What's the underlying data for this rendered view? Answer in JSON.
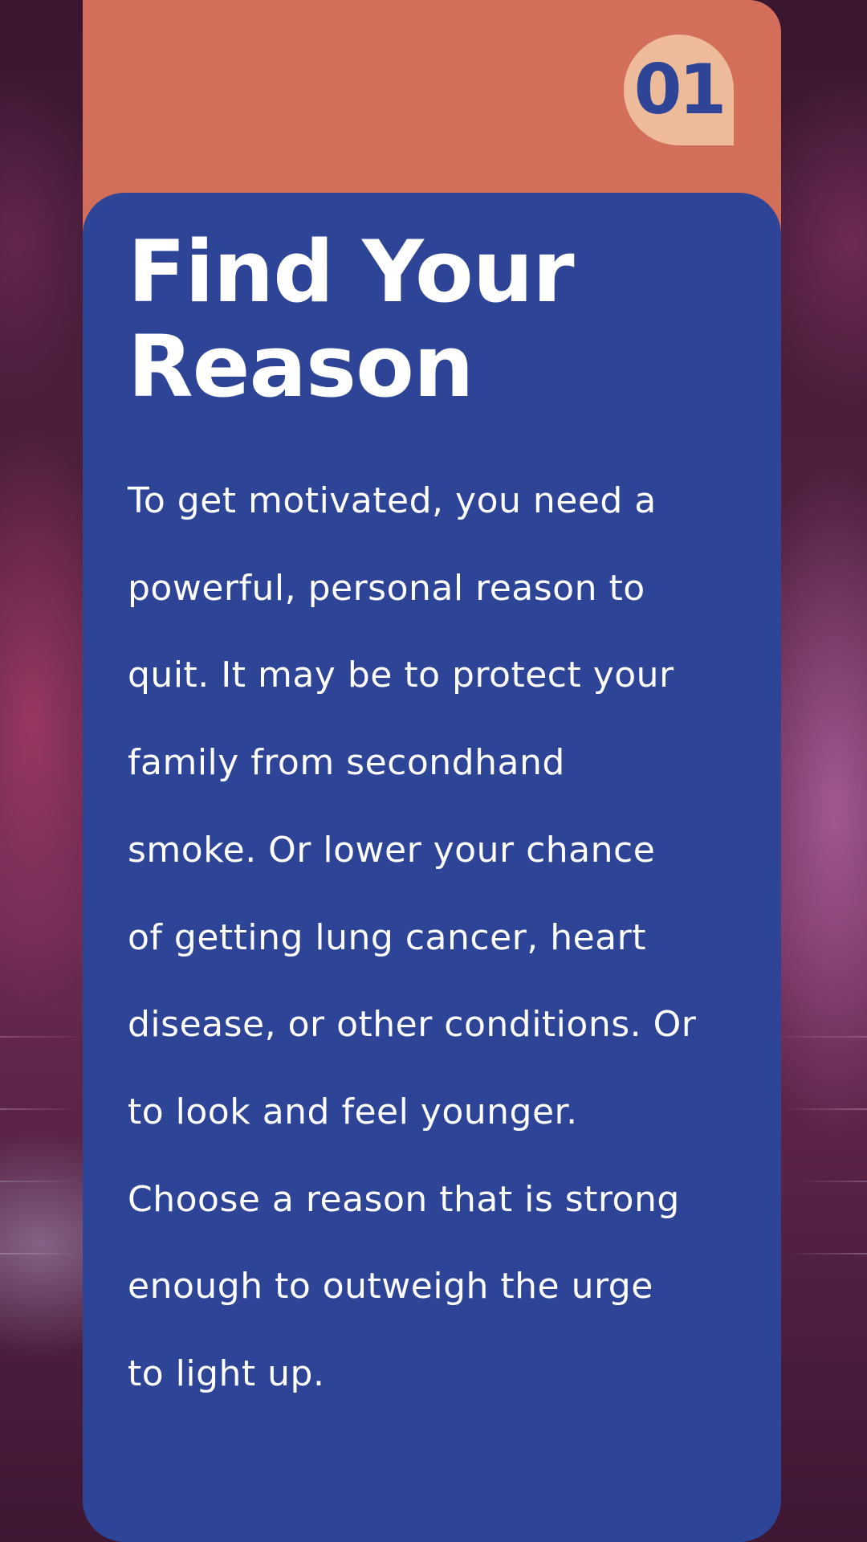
{
  "badge": {
    "number": "01"
  },
  "card": {
    "title": "Find Your Reason",
    "body": "To get motivated, you need a\npowerful, personal reason to\nquit. It may be to protect your\nfamily from secondhand\nsmoke.  Or lower your chance\nof getting lung cancer, heart\ndisease, or other conditions. Or\nto look and feel younger.\nChoose a reason that is strong\nenough to outweigh the urge\nto light up."
  },
  "colors": {
    "header_band": "#d26e5a",
    "card": "#2e4497",
    "badge": "#eebb9a",
    "badge_text": "#2e4497",
    "text": "#ffffff"
  }
}
